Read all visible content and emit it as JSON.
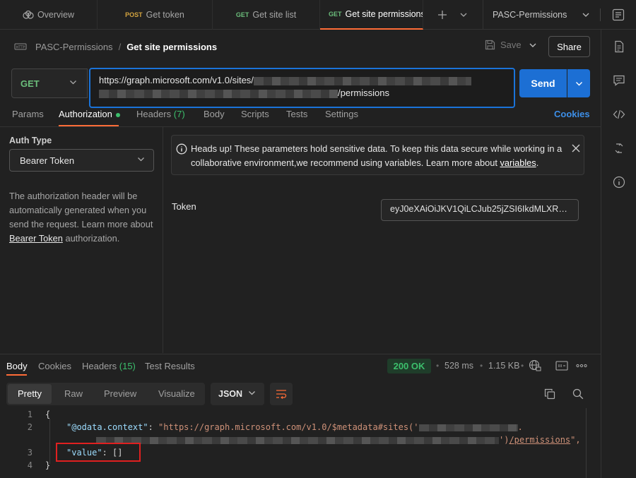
{
  "tabs": {
    "overview": "Overview",
    "get_token": {
      "method": "POST",
      "label": "Get token"
    },
    "site_list": {
      "method": "GET",
      "label": "Get site list"
    },
    "permissions": {
      "method": "GET",
      "label": "Get site permissions"
    }
  },
  "environment": "PASC-Permissions",
  "breadcrumb": {
    "collection": "PASC-Permissions",
    "separator": "/",
    "request": "Get site permissions"
  },
  "toolbar": {
    "save_label": "Save",
    "share_label": "Share"
  },
  "request": {
    "method": "GET",
    "url_prefix": "https://graph.microsoft.com/v1.0/sites/",
    "url_suffix": "/permissions",
    "send_label": "Send"
  },
  "request_tabs": {
    "params": "Params",
    "authorization": "Authorization",
    "headers": "Headers",
    "headers_count": "(7)",
    "body": "Body",
    "scripts": "Scripts",
    "tests": "Tests",
    "settings": "Settings",
    "cookies": "Cookies"
  },
  "auth": {
    "type_label": "Auth Type",
    "type_value": "Bearer Token",
    "desc_before": "The authorization header will be automatically generated when you send the request. Learn more about ",
    "desc_link": "Bearer Token",
    "desc_after": " authorization."
  },
  "warning": {
    "text": "Heads up! These parameters hold sensitive data. To keep this data secure while working in a collaborative environment,we recommend using variables. Learn more about ",
    "link": "variables",
    "end": "."
  },
  "token": {
    "label": "Token",
    "value": "eyJ0eXAiOiJKV1QiLCJub25jZSI6IkdMLXRnT..."
  },
  "response": {
    "tabs": {
      "body": "Body",
      "cookies": "Cookies",
      "headers": "Headers",
      "headers_count": "(15)",
      "test_results": "Test Results"
    },
    "status": "200 OK",
    "time": "528 ms",
    "size": "1.15 KB",
    "views": {
      "pretty": "Pretty",
      "raw": "Raw",
      "preview": "Preview",
      "visualize": "Visualize"
    },
    "format": "JSON",
    "lines": {
      "n1": "1",
      "n2": "2",
      "n3": "3",
      "n4": "4",
      "open": "{",
      "context_key": "\"@odata.context\"",
      "context_val_start": "\"https://graph.microsoft.com/v1.0/$metadata#sites('",
      "context_val_mid": ".",
      "context_val_end_quote": "')",
      "context_val_link": "/permissions",
      "context_val_close": "\",",
      "value_key": "\"value\"",
      "value_val": "[]",
      "close": "}"
    }
  },
  "colors": {
    "accent": "#ff6c37",
    "send": "#1c6fd4",
    "success": "#3cbf6c",
    "highlight": "#e02020"
  }
}
